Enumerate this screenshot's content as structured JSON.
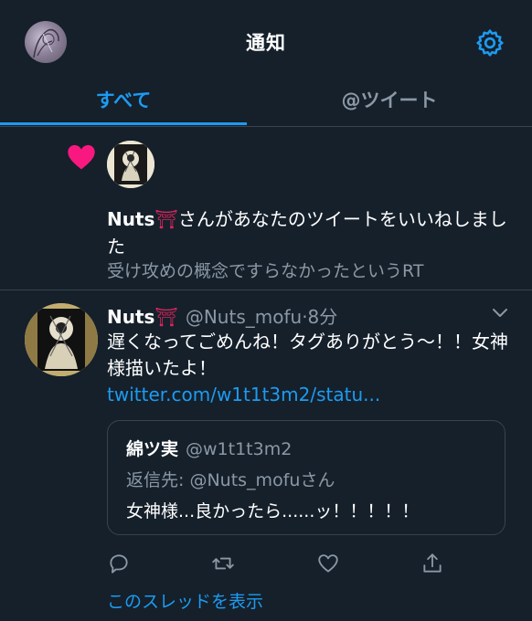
{
  "header": {
    "title": "通知",
    "settings_icon": "gear-icon"
  },
  "tabs": [
    {
      "label": "すべて",
      "active": true
    },
    {
      "label": "@ツイート",
      "active": false
    }
  ],
  "notification": {
    "icon": "heart-icon",
    "user_name": "Nuts",
    "user_emoji": "⛩",
    "action_text": "さんがあなたのツイートをいいねしました",
    "quoted_text": "受け攻めの概念ですらなかったというRT"
  },
  "tweet": {
    "name": "Nuts",
    "emoji": "⛩",
    "handle": "@Nuts_mofu",
    "time": "8分",
    "text": "遅くなってごめんね！タグありがとう〜！！女神様描いたよ！",
    "link": "twitter.com/w1t1t3m2/statu...",
    "quote": {
      "name": "綿ツ実",
      "handle": "@w1t1t3m2",
      "reply_prefix": "返信先: ",
      "reply_to": "@Nuts_mofu",
      "reply_suffix": "さん",
      "text": "女神様...良かったら......ッ！！！！！"
    },
    "actions": [
      "reply-icon",
      "retweet-icon",
      "like-icon",
      "share-icon"
    ],
    "show_thread": "このスレッドを表示"
  },
  "colors": {
    "accent": "#1d9bf0",
    "background": "#15202b",
    "muted": "#8b98a5",
    "like": "#f91880"
  }
}
